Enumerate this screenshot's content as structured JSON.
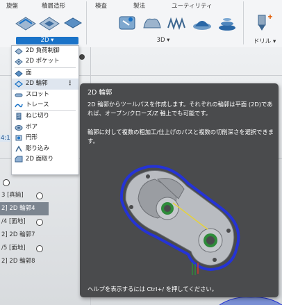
{
  "ribbon": {
    "tabs": [
      "旋盤",
      "積層造形",
      "検査",
      "製法",
      "ユーティリティ"
    ],
    "groups": {
      "g2d": "2D ▾",
      "g3d": "3D ▾",
      "drill": "ドリル ▾"
    }
  },
  "menu": {
    "items": [
      {
        "label": "2D 負荷制御",
        "icon": "adaptive-clearing-icon"
      },
      {
        "label": "2D ポケット",
        "icon": "pocket-icon"
      },
      {
        "label": "面",
        "icon": "face-icon"
      },
      {
        "label": "2D 輪郭",
        "icon": "contour-icon"
      },
      {
        "label": "スロット",
        "icon": "slot-icon"
      },
      {
        "label": "トレース",
        "icon": "trace-icon"
      },
      {
        "label": "ねじ切り",
        "icon": "thread-icon"
      },
      {
        "label": "ボア",
        "icon": "bore-icon"
      },
      {
        "label": "円形",
        "icon": "circular-icon"
      },
      {
        "label": "彫り込み",
        "icon": "engrave-icon"
      },
      {
        "label": "2D 面取り",
        "icon": "chamfer-icon"
      }
    ],
    "more": "⋮"
  },
  "tooltip": {
    "title": "2D 輪郭",
    "p1": "2D 輪郭からツールパスを作成します。それぞれの輪郭は平面 (2D)であれば、オープン/クローズ/Z 軸上でも可能です。",
    "p2": "輪郭に対して複数の粗加工/仕上げのパスと複数の切削深さを選択できます。",
    "footer": "ヘルプを表示するには Ctrl+/ を押してください。"
  },
  "browser": {
    "side_label": "4:1",
    "rows": [
      {
        "text": "3 [真鍮]",
        "selected": false
      },
      {
        "text": "2] 2D 輪郭4",
        "selected": true
      },
      {
        "text": "/4 [面地]",
        "selected": false
      },
      {
        "text": "2] 2D 輪郭7",
        "selected": false
      },
      {
        "text": "/5 [面地]",
        "selected": false
      },
      {
        "text": "2] 2D 輪郭8",
        "selected": false
      }
    ]
  },
  "colors": {
    "accent": "#1a73c8",
    "tooltip_bg": "#4a4b4d",
    "part": "#b9bcc1",
    "toolpath": "#2533d6"
  }
}
